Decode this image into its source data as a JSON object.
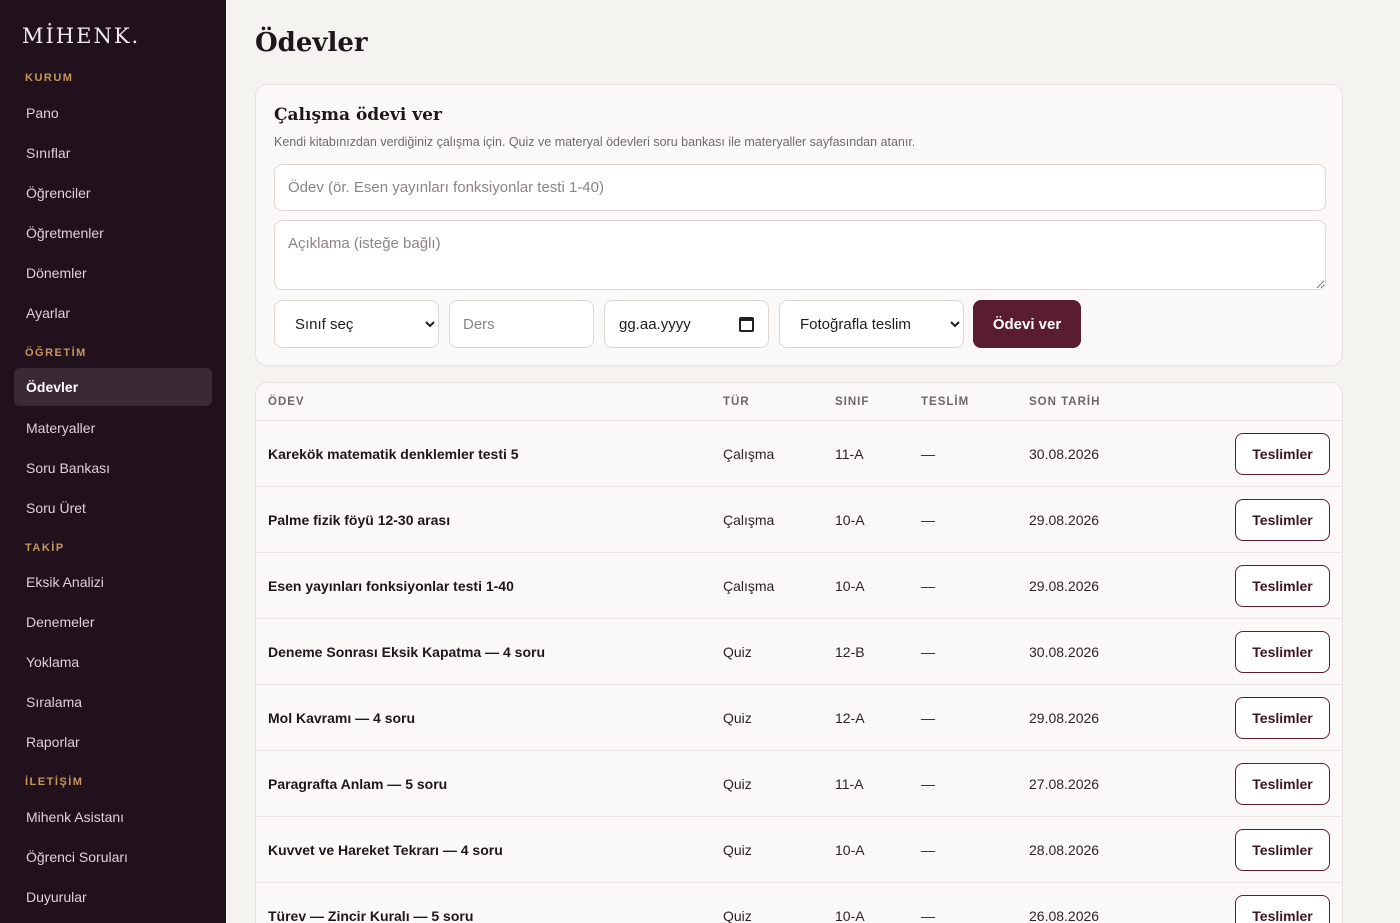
{
  "app": {
    "logo": "MİHENK."
  },
  "sidebar": {
    "sections": [
      {
        "label": "KURUM",
        "items": [
          "Pano",
          "Sınıflar",
          "Öğrenciler",
          "Öğretmenler",
          "Dönemler",
          "Ayarlar"
        ]
      },
      {
        "label": "ÖĞRETİM",
        "items": [
          "Ödevler",
          "Materyaller",
          "Soru Bankası",
          "Soru Üret"
        ]
      },
      {
        "label": "TAKİP",
        "items": [
          "Eksik Analizi",
          "Denemeler",
          "Yoklama",
          "Sıralama",
          "Raporlar"
        ]
      },
      {
        "label": "İLETİŞİM",
        "items": [
          "Mihenk Asistanı",
          "Öğrenci Soruları",
          "Duyurular"
        ]
      }
    ],
    "active_item": "Ödevler"
  },
  "page": {
    "title": "Ödevler"
  },
  "form": {
    "title": "Çalışma ödevi ver",
    "subtitle": "Kendi kitabınızdan verdiğiniz çalışma için. Quiz ve materyal ödevleri soru bankası ile materyaller sayfasından atanır.",
    "task_placeholder": "Ödev (ör. Esen yayınları fonksiyonlar testi 1-40)",
    "description_placeholder": "Açıklama (isteğe bağlı)",
    "class_select": "Sınıf seç",
    "subject_placeholder": "Ders",
    "date_placeholder": "gg.aa.yyyy",
    "delivery_select": "Fotoğrafla teslim",
    "submit_label": "Ödevi ver"
  },
  "table": {
    "headers": {
      "task": "ÖDEV",
      "type": "TÜR",
      "class": "SINIF",
      "submission": "TESLİM",
      "due": "SON TARİH"
    },
    "action_label": "Teslimler",
    "rows": [
      {
        "task": "Karekök matematik denklemler testi 5",
        "type": "Çalışma",
        "class": "11-A",
        "submission": "—",
        "due": "30.08.2026"
      },
      {
        "task": "Palme fizik föyü 12-30 arası",
        "type": "Çalışma",
        "class": "10-A",
        "submission": "—",
        "due": "29.08.2026"
      },
      {
        "task": "Esen yayınları fonksiyonlar testi 1-40",
        "type": "Çalışma",
        "class": "10-A",
        "submission": "—",
        "due": "29.08.2026"
      },
      {
        "task": "Deneme Sonrası Eksik Kapatma — 4 soru",
        "type": "Quiz",
        "class": "12-B",
        "submission": "—",
        "due": "30.08.2026"
      },
      {
        "task": "Mol Kavramı — 4 soru",
        "type": "Quiz",
        "class": "12-A",
        "submission": "—",
        "due": "29.08.2026"
      },
      {
        "task": "Paragrafta Anlam — 5 soru",
        "type": "Quiz",
        "class": "11-A",
        "submission": "—",
        "due": "27.08.2026"
      },
      {
        "task": "Kuvvet ve Hareket Tekrarı — 4 soru",
        "type": "Quiz",
        "class": "10-A",
        "submission": "—",
        "due": "28.08.2026"
      },
      {
        "task": "Türev — Zincir Kuralı — 5 soru",
        "type": "Quiz",
        "class": "10-A",
        "submission": "—",
        "due": "26.08.2026"
      }
    ]
  },
  "colors": {
    "sidebar_bg": "#21111d",
    "accent": "#5a1d2f",
    "section_label": "#c8955a",
    "page_bg": "#f5f3f0"
  }
}
